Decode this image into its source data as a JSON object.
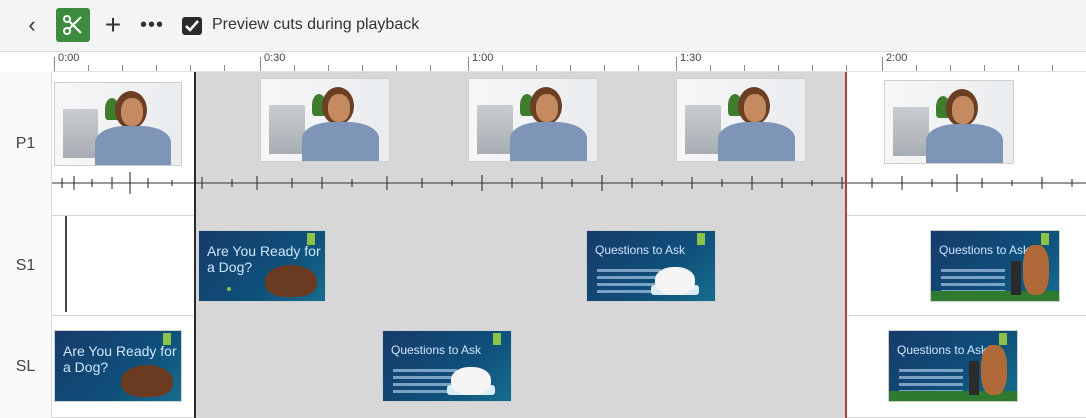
{
  "toolbar": {
    "back_icon": "chevron-left-icon",
    "scissors_icon": "scissors-icon",
    "add_icon": "plus-icon",
    "more_icon": "more-icon",
    "preview_checked": true,
    "preview_label": "Preview cuts during playback"
  },
  "ruler": {
    "labels": [
      "0:00",
      "0:30",
      "1:00",
      "1:30",
      "2:00"
    ]
  },
  "tracks": [
    {
      "label": "P1"
    },
    {
      "label": "S1"
    },
    {
      "label": "SL"
    }
  ],
  "slides": {
    "ready_title": "Are You Ready for a Dog?",
    "questions_title": "Questions to Ask"
  },
  "colors": {
    "accent_green": "#3d8b3d",
    "cut_gray": "#d7d7d7",
    "playhead_red": "#b04040"
  }
}
